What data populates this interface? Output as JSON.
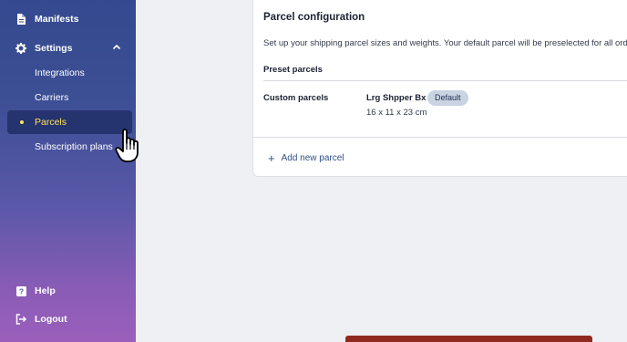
{
  "sidebar": {
    "items": [
      {
        "label": "Manifests",
        "icon": "document-icon"
      },
      {
        "label": "Settings",
        "icon": "gear-icon"
      },
      {
        "label": "Integrations"
      },
      {
        "label": "Carriers"
      },
      {
        "label": "Parcels"
      },
      {
        "label": "Subscription plans"
      }
    ],
    "bottom": [
      {
        "label": "Help",
        "icon": "help-icon"
      },
      {
        "label": "Logout",
        "icon": "logout-icon"
      }
    ],
    "active_color": "#ffe45c"
  },
  "main": {
    "title": "Parcel configuration",
    "description": "Set up your shipping parcel sizes and weights. Your default parcel will be preselected for all ord",
    "preset_label": "Preset parcels",
    "custom_label": "Custom parcels",
    "parcel": {
      "name": "Lrg Shpper Bx",
      "badge": "Default",
      "dims": "16 x 11 x 23 cm"
    },
    "add_label": "Add new parcel"
  }
}
